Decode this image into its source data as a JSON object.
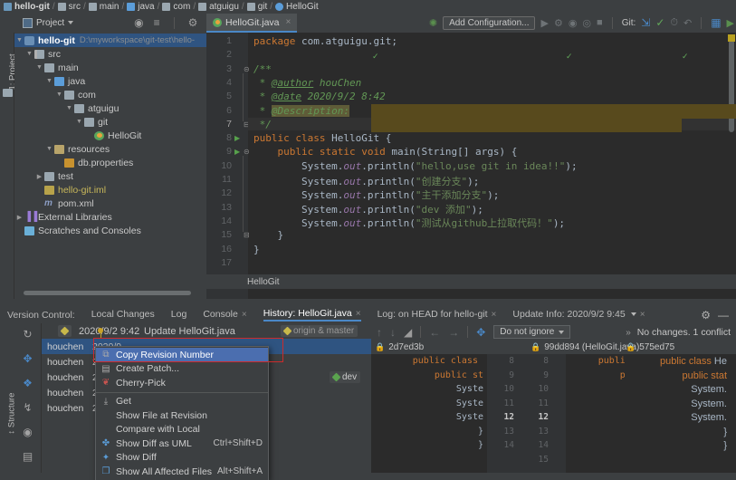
{
  "navbar": {
    "crumbs": [
      "hello-git",
      "src",
      "main",
      "java",
      "com",
      "atguigu",
      "git",
      "HelloGit"
    ]
  },
  "toolbar": {
    "project_label": "Project",
    "add_configuration": "Add Configuration...",
    "git_label": "Git:",
    "editor_tab": "HelloGit.java",
    "close_glyph": "×"
  },
  "sidebar": {
    "rail_label": "1: Project",
    "tree": [
      {
        "indent": 0,
        "arrow": "▼",
        "icon": "module",
        "label": "hello-git",
        "bold": true,
        "path": "D:\\myworkspace\\git-test\\hello-",
        "selected": true
      },
      {
        "indent": 1,
        "arrow": "▼",
        "icon": "folder-src",
        "label": "src",
        "bold": false
      },
      {
        "indent": 2,
        "arrow": "▼",
        "icon": "folder",
        "label": "main",
        "bold": false
      },
      {
        "indent": 3,
        "arrow": "▼",
        "icon": "folder-b",
        "label": "java",
        "bold": false
      },
      {
        "indent": 4,
        "arrow": "▼",
        "icon": "folder",
        "label": "com",
        "bold": false
      },
      {
        "indent": 5,
        "arrow": "▼",
        "icon": "folder",
        "label": "atguigu",
        "bold": false
      },
      {
        "indent": 6,
        "arrow": "▼",
        "icon": "folder",
        "label": "git",
        "bold": false
      },
      {
        "indent": 7,
        "arrow": "",
        "icon": "javacls",
        "label": "HelloGit",
        "bold": false
      },
      {
        "indent": 3,
        "arrow": "▼",
        "icon": "folder-res",
        "label": "resources",
        "bold": false
      },
      {
        "indent": 4,
        "arrow": "",
        "icon": "props",
        "label": "db.properties",
        "bold": false
      },
      {
        "indent": 2,
        "arrow": "▶",
        "icon": "folder",
        "label": "test",
        "bold": false
      },
      {
        "indent": 2,
        "arrow": "",
        "icon": "iml",
        "label": "hello-git.iml",
        "bold": false,
        "yellow": true
      },
      {
        "indent": 2,
        "arrow": "",
        "icon": "pom",
        "label": "pom.xml",
        "bold": false,
        "glyph": "m"
      },
      {
        "indent": 0,
        "arrow": "▶",
        "icon": "libs",
        "label": "External Libraries",
        "bold": false,
        "glyph": "▐▐"
      },
      {
        "indent": 0,
        "arrow": "",
        "icon": "scratch",
        "label": "Scratches and Consoles",
        "bold": false
      }
    ]
  },
  "editor": {
    "breadcrumb": "HelloGit",
    "lines": [
      {
        "n": 1,
        "segments": [
          {
            "t": "package",
            "c": "kw"
          },
          {
            "t": " com.atguigu.git;",
            "c": "pl"
          }
        ]
      },
      {
        "n": 2,
        "segments": []
      },
      {
        "n": 3,
        "segments": [
          {
            "t": "/**",
            "c": "cm"
          }
        ],
        "fold": true
      },
      {
        "n": 4,
        "segments": [
          {
            "t": " * ",
            "c": "cm"
          },
          {
            "t": "@author",
            "c": "tagd"
          },
          {
            "t": " houChen",
            "c": "cm"
          }
        ]
      },
      {
        "n": 5,
        "segments": [
          {
            "t": " * ",
            "c": "cm"
          },
          {
            "t": "@date",
            "c": "tagd"
          },
          {
            "t": " 2020/9/2 8:42",
            "c": "cm"
          }
        ]
      },
      {
        "n": 6,
        "segments": [
          {
            "t": " * ",
            "c": "cm"
          },
          {
            "t": "@Description:",
            "c": "tagh"
          }
        ]
      },
      {
        "n": 7,
        "segments": [
          {
            "t": " */",
            "c": "cm"
          }
        ],
        "current": true,
        "foldend": true
      },
      {
        "n": 8,
        "segments": [
          {
            "t": "public class ",
            "c": "kw"
          },
          {
            "t": "HelloGit {",
            "c": "pl"
          }
        ],
        "run": true
      },
      {
        "n": 9,
        "segments": [
          {
            "t": "    public static void ",
            "c": "kw"
          },
          {
            "t": "main(String[] args) {",
            "c": "pl"
          }
        ],
        "run": true,
        "fold": true
      },
      {
        "n": 10,
        "segments": [
          {
            "t": "        System.",
            "c": "pl"
          },
          {
            "t": "out",
            "c": "fld"
          },
          {
            "t": ".println(",
            "c": "pl"
          },
          {
            "t": "\"hello,use git in idea!!\"",
            "c": "st"
          },
          {
            "t": ");",
            "c": "pl"
          }
        ]
      },
      {
        "n": 11,
        "segments": [
          {
            "t": "        System.",
            "c": "pl"
          },
          {
            "t": "out",
            "c": "fld"
          },
          {
            "t": ".println(",
            "c": "pl"
          },
          {
            "t": "\"创建分支\"",
            "c": "st"
          },
          {
            "t": ");",
            "c": "pl"
          }
        ]
      },
      {
        "n": 12,
        "segments": [
          {
            "t": "        System.",
            "c": "pl"
          },
          {
            "t": "out",
            "c": "fld"
          },
          {
            "t": ".println(",
            "c": "pl"
          },
          {
            "t": "\"主干添加分支\"",
            "c": "st"
          },
          {
            "t": ");",
            "c": "pl"
          }
        ]
      },
      {
        "n": 13,
        "segments": [
          {
            "t": "        System.",
            "c": "pl"
          },
          {
            "t": "out",
            "c": "fld"
          },
          {
            "t": ".println(",
            "c": "pl"
          },
          {
            "t": "\"dev 添加\"",
            "c": "st"
          },
          {
            "t": ");",
            "c": "pl"
          }
        ]
      },
      {
        "n": 14,
        "segments": [
          {
            "t": "        System.",
            "c": "pl"
          },
          {
            "t": "out",
            "c": "fld"
          },
          {
            "t": ".println(",
            "c": "pl"
          },
          {
            "t": "\"测试从github上拉取代码！\"",
            "c": "st"
          },
          {
            "t": ");",
            "c": "pl"
          }
        ]
      },
      {
        "n": 15,
        "segments": [
          {
            "t": "    }",
            "c": "pl"
          }
        ],
        "foldend": true
      },
      {
        "n": 16,
        "segments": [
          {
            "t": "}",
            "c": "pl"
          }
        ]
      },
      {
        "n": 17,
        "segments": []
      }
    ]
  },
  "vcs": {
    "panel_title": "Version Control:",
    "tabs": [
      {
        "label": "Local Changes",
        "active": false,
        "closable": false
      },
      {
        "label": "Log",
        "active": false,
        "closable": false
      },
      {
        "label": "Console",
        "active": false,
        "closable": true
      },
      {
        "label": "History: HelloGit.java",
        "active": true,
        "closable": true
      },
      {
        "label": "Log: on HEAD for hello-git",
        "active": false,
        "closable": true
      },
      {
        "label": "Update Info: 2020/9/2 9:45",
        "active": false,
        "closable": true,
        "dropdown": true
      }
    ],
    "rail_label": "↕ Structure",
    "commit_header": {
      "date": "2020/9/2 9:42",
      "message": "Update HelloGit.java",
      "branch_tag": "origin & master"
    },
    "commits": [
      {
        "author": "houchen",
        "date": "2020/9",
        "message": "",
        "selected": true
      },
      {
        "author": "houchen",
        "date": "2020/",
        "message": "",
        "selected": false
      },
      {
        "author": "houchen",
        "date": "2020/",
        "message": "",
        "selected": false,
        "tag": "dev"
      },
      {
        "author": "houchen",
        "date": "2020/",
        "message": "",
        "selected": false
      },
      {
        "author": "houchen",
        "date": "2020/",
        "message": "",
        "selected": false
      }
    ],
    "diff_toolbar": {
      "ignore_label": "Do not ignore",
      "status": "No changes. 1 conflict"
    }
  },
  "diff": {
    "panes": [
      {
        "revision": "2d7ed3b",
        "file": ""
      },
      {
        "revision": "99dd894",
        "file": "(HelloGit.java)"
      },
      {
        "revision": "575ed75",
        "file": ""
      }
    ],
    "left_lines": [
      "public class ",
      "    public st",
      "        Syste",
      "        Syste",
      "        Syste",
      "    }",
      "}"
    ],
    "center_lines": [
      "public class He",
      "    public stat",
      "        System.",
      "        System.",
      "        System.",
      "        System.",
      "    }",
      "}"
    ],
    "right_lines": [
      "public class He",
      "    public stat",
      "        System.",
      "        System.",
      "        System.",
      "    }",
      "}"
    ],
    "left_numbers": [
      "8",
      "9",
      "10",
      "11",
      "12",
      "13",
      "14"
    ],
    "right_numbers": [
      "8",
      "9",
      "10",
      "11",
      "12",
      "13",
      "14",
      "15"
    ],
    "far_numbers": [
      "8",
      "9",
      "10",
      "11",
      "12",
      "13",
      "14"
    ]
  },
  "context_menu": {
    "items": [
      {
        "label": "Copy Revision Number",
        "icon": "copy-icon",
        "shortcut": "",
        "highlight": true,
        "sep_after": false
      },
      {
        "label": "Create Patch...",
        "icon": "patch-icon",
        "shortcut": "",
        "highlight": false,
        "sep_after": false
      },
      {
        "label": "Cherry-Pick",
        "icon": "cherry-icon",
        "shortcut": "",
        "highlight": false,
        "sep_after": true
      },
      {
        "label": "Get",
        "icon": "download-icon",
        "shortcut": "",
        "highlight": false,
        "sep_after": false
      },
      {
        "label": "Show File at Revision",
        "icon": "",
        "shortcut": "",
        "highlight": false,
        "sep_after": false
      },
      {
        "label": "Compare with Local",
        "icon": "",
        "shortcut": "",
        "highlight": false,
        "sep_after": false
      },
      {
        "label": "Show Diff as UML",
        "icon": "uml-icon",
        "shortcut": "Ctrl+Shift+D",
        "highlight": false,
        "sep_after": false
      },
      {
        "label": "Show Diff",
        "icon": "diff-icon",
        "shortcut": "",
        "highlight": false,
        "sep_after": false
      },
      {
        "label": "Show All Affected Files",
        "icon": "files-icon",
        "shortcut": "Alt+Shift+A",
        "highlight": false,
        "sep_after": false
      }
    ]
  },
  "colors": {
    "accent": "#4a88c7",
    "selection": "#2f5481",
    "menu_highlight": "#4b6eaf",
    "annotation_red": "#cc2b2b",
    "conflict_yellow": "#584a1d",
    "editor_bg": "#2b2b2b",
    "panel_bg": "#3c3f41"
  }
}
